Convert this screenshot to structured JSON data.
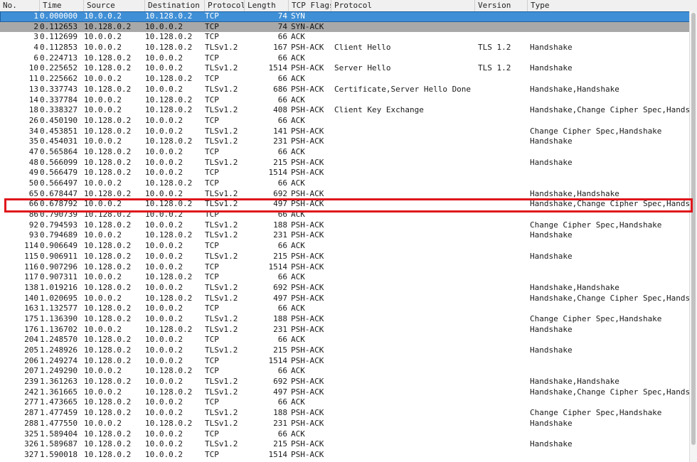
{
  "columns": {
    "no": "No.",
    "time": "Time",
    "source": "Source",
    "destination": "Destination",
    "protocol": "Protocol",
    "length": "Length",
    "tcp_flags": "TCP Flags",
    "tls_protocol": "Protocol",
    "version": "Version",
    "type": "Type"
  },
  "packets": [
    {
      "no": "1",
      "time": "0.000000",
      "src": "10.0.0.2",
      "dst": "10.128.0.2",
      "proto": "TCP",
      "len": "74",
      "flags": "SYN",
      "tproto": "",
      "ver": "",
      "type": ""
    },
    {
      "no": "2",
      "time": "0.112653",
      "src": "10.128.0.2",
      "dst": "10.0.0.2",
      "proto": "TCP",
      "len": "74",
      "flags": "SYN-ACK",
      "tproto": "",
      "ver": "",
      "type": ""
    },
    {
      "no": "3",
      "time": "0.112699",
      "src": "10.0.0.2",
      "dst": "10.128.0.2",
      "proto": "TCP",
      "len": "66",
      "flags": "ACK",
      "tproto": "",
      "ver": "",
      "type": ""
    },
    {
      "no": "4",
      "time": "0.112853",
      "src": "10.0.0.2",
      "dst": "10.128.0.2",
      "proto": "TLSv1.2",
      "len": "167",
      "flags": "PSH-ACK",
      "tproto": "Client Hello",
      "ver": "TLS 1.2",
      "type": "Handshake"
    },
    {
      "no": "6",
      "time": "0.224713",
      "src": "10.128.0.2",
      "dst": "10.0.0.2",
      "proto": "TCP",
      "len": "66",
      "flags": "ACK",
      "tproto": "",
      "ver": "",
      "type": ""
    },
    {
      "no": "10",
      "time": "0.225652",
      "src": "10.128.0.2",
      "dst": "10.0.0.2",
      "proto": "TLSv1.2",
      "len": "1514",
      "flags": "PSH-ACK",
      "tproto": "Server Hello",
      "ver": "TLS 1.2",
      "type": "Handshake"
    },
    {
      "no": "11",
      "time": "0.225662",
      "src": "10.0.0.2",
      "dst": "10.128.0.2",
      "proto": "TCP",
      "len": "66",
      "flags": "ACK",
      "tproto": "",
      "ver": "",
      "type": ""
    },
    {
      "no": "13",
      "time": "0.337743",
      "src": "10.128.0.2",
      "dst": "10.0.0.2",
      "proto": "TLSv1.2",
      "len": "686",
      "flags": "PSH-ACK",
      "tproto": "Certificate,Server Hello Done",
      "ver": "",
      "type": "Handshake,Handshake"
    },
    {
      "no": "14",
      "time": "0.337784",
      "src": "10.0.0.2",
      "dst": "10.128.0.2",
      "proto": "TCP",
      "len": "66",
      "flags": "ACK",
      "tproto": "",
      "ver": "",
      "type": ""
    },
    {
      "no": "18",
      "time": "0.338327",
      "src": "10.0.0.2",
      "dst": "10.128.0.2",
      "proto": "TLSv1.2",
      "len": "408",
      "flags": "PSH-ACK",
      "tproto": "Client Key Exchange",
      "ver": "",
      "type": "Handshake,Change Cipher Spec,Handsh"
    },
    {
      "no": "26",
      "time": "0.450190",
      "src": "10.128.0.2",
      "dst": "10.0.0.2",
      "proto": "TCP",
      "len": "66",
      "flags": "ACK",
      "tproto": "",
      "ver": "",
      "type": ""
    },
    {
      "no": "34",
      "time": "0.453851",
      "src": "10.128.0.2",
      "dst": "10.0.0.2",
      "proto": "TLSv1.2",
      "len": "141",
      "flags": "PSH-ACK",
      "tproto": "",
      "ver": "",
      "type": "Change Cipher Spec,Handshake"
    },
    {
      "no": "35",
      "time": "0.454031",
      "src": "10.0.0.2",
      "dst": "10.128.0.2",
      "proto": "TLSv1.2",
      "len": "231",
      "flags": "PSH-ACK",
      "tproto": "",
      "ver": "",
      "type": "Handshake"
    },
    {
      "no": "47",
      "time": "0.565864",
      "src": "10.128.0.2",
      "dst": "10.0.0.2",
      "proto": "TCP",
      "len": "66",
      "flags": "ACK",
      "tproto": "",
      "ver": "",
      "type": ""
    },
    {
      "no": "48",
      "time": "0.566099",
      "src": "10.128.0.2",
      "dst": "10.0.0.2",
      "proto": "TLSv1.2",
      "len": "215",
      "flags": "PSH-ACK",
      "tproto": "",
      "ver": "",
      "type": "Handshake"
    },
    {
      "no": "49",
      "time": "0.566479",
      "src": "10.128.0.2",
      "dst": "10.0.0.2",
      "proto": "TCP",
      "len": "1514",
      "flags": "PSH-ACK",
      "tproto": "",
      "ver": "",
      "type": ""
    },
    {
      "no": "50",
      "time": "0.566497",
      "src": "10.0.0.2",
      "dst": "10.128.0.2",
      "proto": "TCP",
      "len": "66",
      "flags": "ACK",
      "tproto": "",
      "ver": "",
      "type": ""
    },
    {
      "no": "65",
      "time": "0.678447",
      "src": "10.128.0.2",
      "dst": "10.0.0.2",
      "proto": "TLSv1.2",
      "len": "692",
      "flags": "PSH-ACK",
      "tproto": "",
      "ver": "",
      "type": "Handshake,Handshake"
    },
    {
      "no": "66",
      "time": "0.678792",
      "src": "10.0.0.2",
      "dst": "10.128.0.2",
      "proto": "TLSv1.2",
      "len": "497",
      "flags": "PSH-ACK",
      "tproto": "",
      "ver": "",
      "type": "Handshake,Change Cipher Spec,Handsh"
    },
    {
      "no": "86",
      "time": "0.790739",
      "src": "10.128.0.2",
      "dst": "10.0.0.2",
      "proto": "TCP",
      "len": "66",
      "flags": "ACK",
      "tproto": "",
      "ver": "",
      "type": ""
    },
    {
      "no": "92",
      "time": "0.794593",
      "src": "10.128.0.2",
      "dst": "10.0.0.2",
      "proto": "TLSv1.2",
      "len": "188",
      "flags": "PSH-ACK",
      "tproto": "",
      "ver": "",
      "type": "Change Cipher Spec,Handshake"
    },
    {
      "no": "93",
      "time": "0.794689",
      "src": "10.0.0.2",
      "dst": "10.128.0.2",
      "proto": "TLSv1.2",
      "len": "231",
      "flags": "PSH-ACK",
      "tproto": "",
      "ver": "",
      "type": "Handshake"
    },
    {
      "no": "114",
      "time": "0.906649",
      "src": "10.128.0.2",
      "dst": "10.0.0.2",
      "proto": "TCP",
      "len": "66",
      "flags": "ACK",
      "tproto": "",
      "ver": "",
      "type": ""
    },
    {
      "no": "115",
      "time": "0.906911",
      "src": "10.128.0.2",
      "dst": "10.0.0.2",
      "proto": "TLSv1.2",
      "len": "215",
      "flags": "PSH-ACK",
      "tproto": "",
      "ver": "",
      "type": "Handshake"
    },
    {
      "no": "116",
      "time": "0.907296",
      "src": "10.128.0.2",
      "dst": "10.0.0.2",
      "proto": "TCP",
      "len": "1514",
      "flags": "PSH-ACK",
      "tproto": "",
      "ver": "",
      "type": ""
    },
    {
      "no": "117",
      "time": "0.907311",
      "src": "10.0.0.2",
      "dst": "10.128.0.2",
      "proto": "TCP",
      "len": "66",
      "flags": "ACK",
      "tproto": "",
      "ver": "",
      "type": ""
    },
    {
      "no": "138",
      "time": "1.019216",
      "src": "10.128.0.2",
      "dst": "10.0.0.2",
      "proto": "TLSv1.2",
      "len": "692",
      "flags": "PSH-ACK",
      "tproto": "",
      "ver": "",
      "type": "Handshake,Handshake"
    },
    {
      "no": "140",
      "time": "1.020695",
      "src": "10.0.0.2",
      "dst": "10.128.0.2",
      "proto": "TLSv1.2",
      "len": "497",
      "flags": "PSH-ACK",
      "tproto": "",
      "ver": "",
      "type": "Handshake,Change Cipher Spec,Handsh"
    },
    {
      "no": "163",
      "time": "1.132577",
      "src": "10.128.0.2",
      "dst": "10.0.0.2",
      "proto": "TCP",
      "len": "66",
      "flags": "ACK",
      "tproto": "",
      "ver": "",
      "type": ""
    },
    {
      "no": "175",
      "time": "1.136390",
      "src": "10.128.0.2",
      "dst": "10.0.0.2",
      "proto": "TLSv1.2",
      "len": "188",
      "flags": "PSH-ACK",
      "tproto": "",
      "ver": "",
      "type": "Change Cipher Spec,Handshake"
    },
    {
      "no": "176",
      "time": "1.136702",
      "src": "10.0.0.2",
      "dst": "10.128.0.2",
      "proto": "TLSv1.2",
      "len": "231",
      "flags": "PSH-ACK",
      "tproto": "",
      "ver": "",
      "type": "Handshake"
    },
    {
      "no": "204",
      "time": "1.248570",
      "src": "10.128.0.2",
      "dst": "10.0.0.2",
      "proto": "TCP",
      "len": "66",
      "flags": "ACK",
      "tproto": "",
      "ver": "",
      "type": ""
    },
    {
      "no": "205",
      "time": "1.248926",
      "src": "10.128.0.2",
      "dst": "10.0.0.2",
      "proto": "TLSv1.2",
      "len": "215",
      "flags": "PSH-ACK",
      "tproto": "",
      "ver": "",
      "type": "Handshake"
    },
    {
      "no": "206",
      "time": "1.249274",
      "src": "10.128.0.2",
      "dst": "10.0.0.2",
      "proto": "TCP",
      "len": "1514",
      "flags": "PSH-ACK",
      "tproto": "",
      "ver": "",
      "type": ""
    },
    {
      "no": "207",
      "time": "1.249290",
      "src": "10.0.0.2",
      "dst": "10.128.0.2",
      "proto": "TCP",
      "len": "66",
      "flags": "ACK",
      "tproto": "",
      "ver": "",
      "type": ""
    },
    {
      "no": "239",
      "time": "1.361263",
      "src": "10.128.0.2",
      "dst": "10.0.0.2",
      "proto": "TLSv1.2",
      "len": "692",
      "flags": "PSH-ACK",
      "tproto": "",
      "ver": "",
      "type": "Handshake,Handshake"
    },
    {
      "no": "242",
      "time": "1.361665",
      "src": "10.0.0.2",
      "dst": "10.128.0.2",
      "proto": "TLSv1.2",
      "len": "497",
      "flags": "PSH-ACK",
      "tproto": "",
      "ver": "",
      "type": "Handshake,Change Cipher Spec,Handsh"
    },
    {
      "no": "277",
      "time": "1.473665",
      "src": "10.128.0.2",
      "dst": "10.0.0.2",
      "proto": "TCP",
      "len": "66",
      "flags": "ACK",
      "tproto": "",
      "ver": "",
      "type": ""
    },
    {
      "no": "287",
      "time": "1.477459",
      "src": "10.128.0.2",
      "dst": "10.0.0.2",
      "proto": "TLSv1.2",
      "len": "188",
      "flags": "PSH-ACK",
      "tproto": "",
      "ver": "",
      "type": "Change Cipher Spec,Handshake"
    },
    {
      "no": "288",
      "time": "1.477550",
      "src": "10.0.0.2",
      "dst": "10.128.0.2",
      "proto": "TLSv1.2",
      "len": "231",
      "flags": "PSH-ACK",
      "tproto": "",
      "ver": "",
      "type": "Handshake"
    },
    {
      "no": "325",
      "time": "1.589404",
      "src": "10.128.0.2",
      "dst": "10.0.0.2",
      "proto": "TCP",
      "len": "66",
      "flags": "ACK",
      "tproto": "",
      "ver": "",
      "type": ""
    },
    {
      "no": "326",
      "time": "1.589687",
      "src": "10.128.0.2",
      "dst": "10.0.0.2",
      "proto": "TLSv1.2",
      "len": "215",
      "flags": "PSH-ACK",
      "tproto": "",
      "ver": "",
      "type": "Handshake"
    },
    {
      "no": "327",
      "time": "1.590018",
      "src": "10.128.0.2",
      "dst": "10.0.0.2",
      "proto": "TCP",
      "len": "1514",
      "flags": "PSH-ACK",
      "tproto": "",
      "ver": "",
      "type": ""
    }
  ],
  "selected_row_index": 0,
  "marked_row_index": 1,
  "highlighted_row_index": 18,
  "colors": {
    "selected": "#3f8fd6",
    "marked": "#a8a8a8",
    "highlight_border": "#e0161b"
  }
}
